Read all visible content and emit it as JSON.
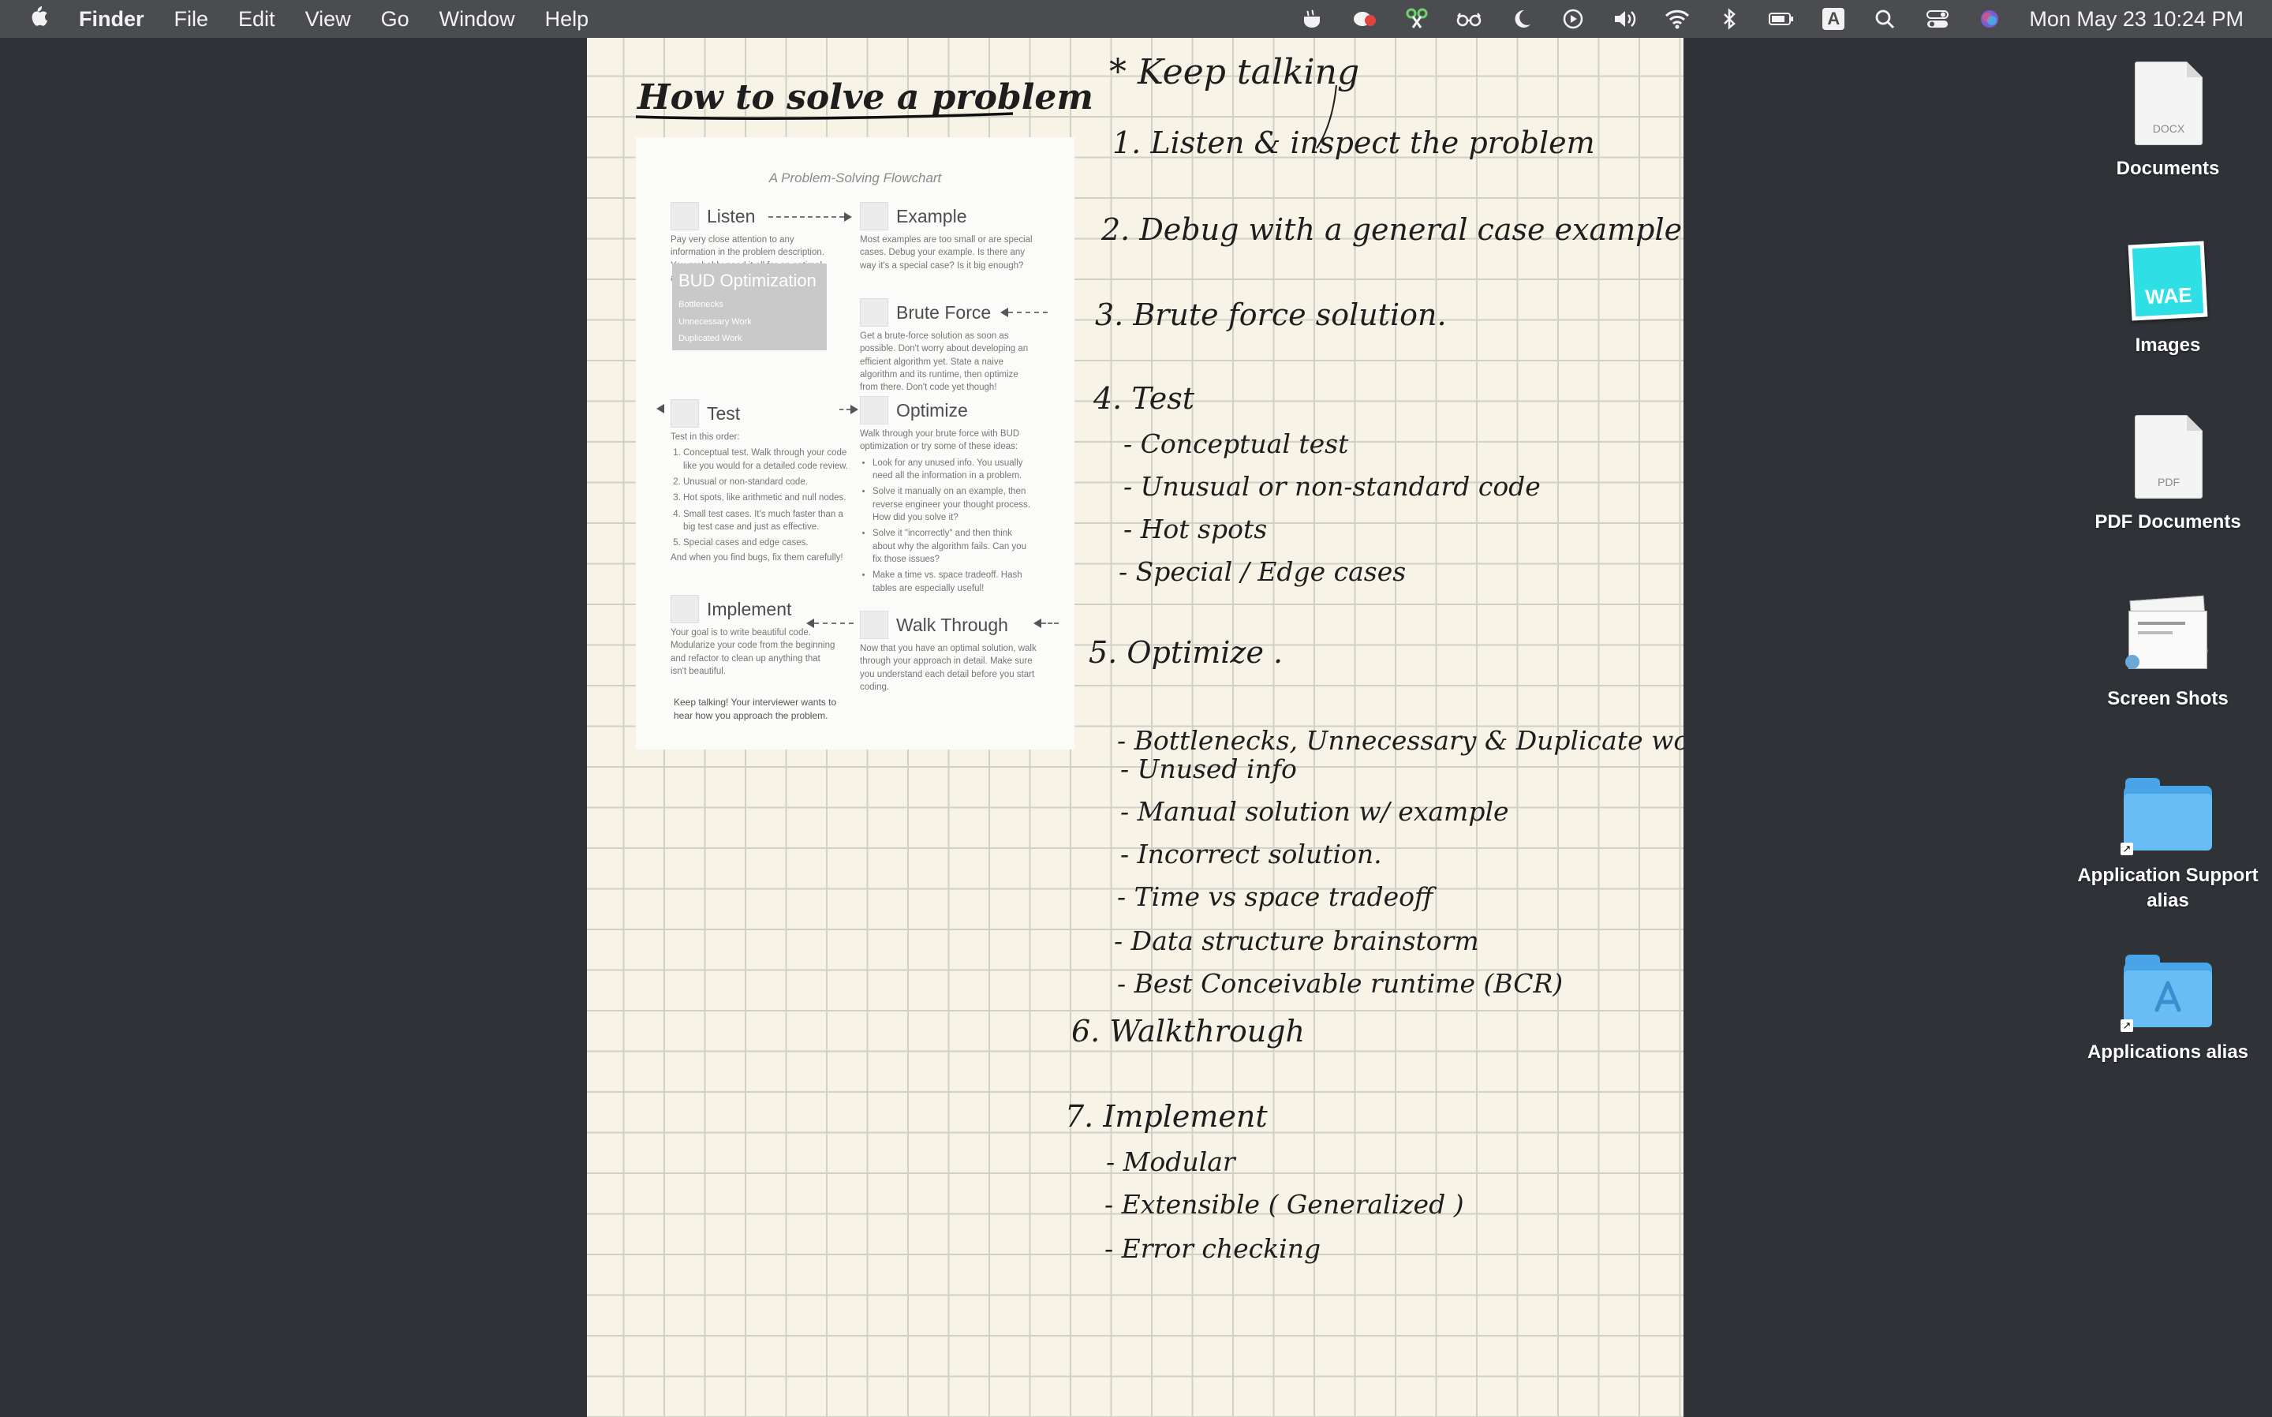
{
  "menubar": {
    "apple": "",
    "app_name": "Finder",
    "menus": [
      "File",
      "Edit",
      "View",
      "Go",
      "Window",
      "Help"
    ],
    "status_icons": [
      "cup-icon",
      "record-icon",
      "scissors-icon",
      "glasses-icon",
      "moon-icon",
      "play-icon",
      "volume-icon",
      "wifi-icon",
      "bluetooth-icon",
      "battery-icon",
      "input-source-icon",
      "spotlight-icon",
      "control-center-icon",
      "siri-icon"
    ],
    "input_source": "A",
    "clock": "Mon May 23  10:24 PM"
  },
  "notes": {
    "title": "How to solve a problem",
    "keep_talking": "* Keep talking",
    "steps": [
      "1.  Listen & inspect the problem",
      "2.  Debug with a general case example",
      "3.  Brute force solution.",
      "4.  Test",
      "5.  Optimize .",
      "6.  Walkthrough",
      "7.  Implement"
    ],
    "test_items": [
      "- Conceptual test",
      "- Unusual  or  non-standard  code",
      "- Hot  spots",
      "- Special / Edge  cases"
    ],
    "optimize_items": [
      "- Bottlenecks, Unnecessary & Duplicate work",
      "- Unused  info",
      "- Manual  solution  w/ example",
      "- Incorrect  solution.",
      "- Time  vs  space  tradeoff",
      "- Data  structure  brainstorm",
      "- Best  Conceivable  runtime  (BCR)"
    ],
    "implement_items": [
      "- Modular",
      "- Extensible  ( Generalized )",
      "- Error  checking"
    ]
  },
  "flowchart": {
    "caption": "A Problem-Solving Flowchart",
    "listen": {
      "title": "Listen",
      "text": "Pay very close attention to any information in the problem description. You probably need it all for an optimal algorithm."
    },
    "example": {
      "title": "Example",
      "text": "Most examples are too small or are special cases. Debug your example. Is there any way it's a special case? Is it big enough?"
    },
    "bud": {
      "title": "BUD Optimization",
      "items": [
        "Bottlenecks",
        "Unnecessary Work",
        "Duplicated Work"
      ]
    },
    "brute_force": {
      "title": "Brute Force",
      "text": "Get a brute-force solution as soon as possible. Don't worry about developing an efficient algorithm yet. State a naive algorithm and its runtime, then optimize from there. Don't code yet though!"
    },
    "test": {
      "title": "Test",
      "intro": "Test in this order:",
      "items": [
        "Conceptual test. Walk through your code like you would for a detailed code review.",
        "Unusual or non-standard code.",
        "Hot spots, like arithmetic and null nodes.",
        "Small test cases. It's much faster than a big test case and just as effective.",
        "Special cases and edge cases."
      ],
      "outro": "And when you find bugs, fix them carefully!"
    },
    "optimize": {
      "title": "Optimize",
      "intro": "Walk through your brute force with BUD optimization or try some of these ideas:",
      "items": [
        "Look for any unused info. You usually need all the information in a problem.",
        "Solve it manually on an example, then reverse engineer your thought process. How did you solve it?",
        "Solve it \"incorrectly\" and then think about why the algorithm fails. Can you fix those issues?",
        "Make a time vs. space tradeoff. Hash tables are especially useful!"
      ]
    },
    "implement": {
      "title": "Implement",
      "text": "Your goal is to write beautiful code. Modularize your code from the beginning and refactor to clean up anything that isn't beautiful."
    },
    "walk_through": {
      "title": "Walk Through",
      "text": "Now that you have an optimal solution, walk through your approach in detail. Make sure you understand each detail before you start coding."
    },
    "footer": "Keep talking! Your interviewer wants to hear how you approach the problem."
  },
  "desktop": {
    "icons": [
      {
        "label": "Documents",
        "badge": "DOCX"
      },
      {
        "label": "Images",
        "badge": "WAE"
      },
      {
        "label": "PDF Documents",
        "badge": "PDF"
      },
      {
        "label": "Screen Shots"
      },
      {
        "label": "Application Support alias"
      },
      {
        "label": "Applications alias"
      }
    ]
  }
}
